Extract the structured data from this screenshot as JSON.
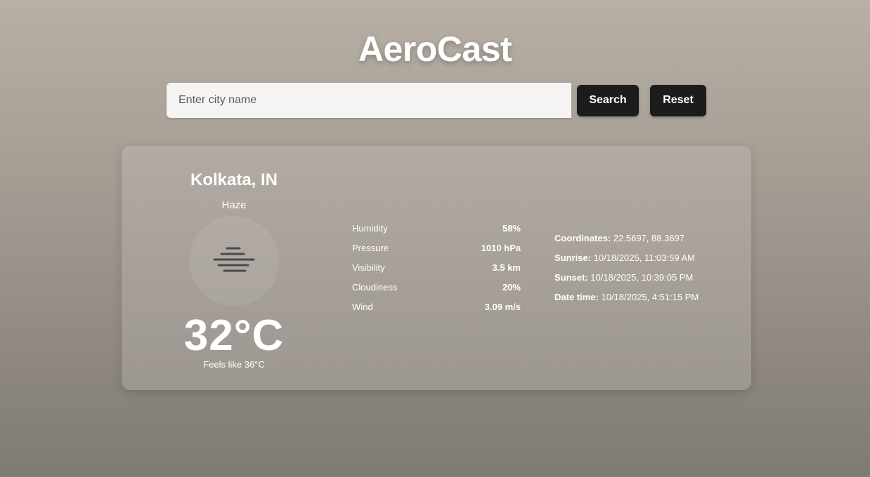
{
  "app": {
    "title": "AeroCast"
  },
  "search": {
    "placeholder": "Enter city name",
    "value": "",
    "search_label": "Search",
    "reset_label": "Reset"
  },
  "weather": {
    "city": "Kolkata, IN",
    "condition": "Haze",
    "icon": "haze-icon",
    "temperature": "32°C",
    "feels_like": "Feels like 36°C",
    "stats": [
      {
        "label": "Humidity",
        "value": "58%"
      },
      {
        "label": "Pressure",
        "value": "1010 hPa"
      },
      {
        "label": "Visibility",
        "value": "3.5 km"
      },
      {
        "label": "Cloudiness",
        "value": "20%"
      },
      {
        "label": "Wind",
        "value": "3.09 m/s"
      }
    ],
    "details": [
      {
        "label": "Coordinates:",
        "value": "22.5697, 88.3697"
      },
      {
        "label": "Sunrise:",
        "value": "10/18/2025, 11:03:59 AM"
      },
      {
        "label": "Sunset:",
        "value": "10/18/2025, 10:39:05 PM"
      },
      {
        "label": "Date time:",
        "value": "10/18/2025, 4:51:15 PM"
      }
    ]
  },
  "colors": {
    "button_bg": "#1c1c1c",
    "input_bg": "#f5f4f2",
    "text": "#ffffff"
  }
}
